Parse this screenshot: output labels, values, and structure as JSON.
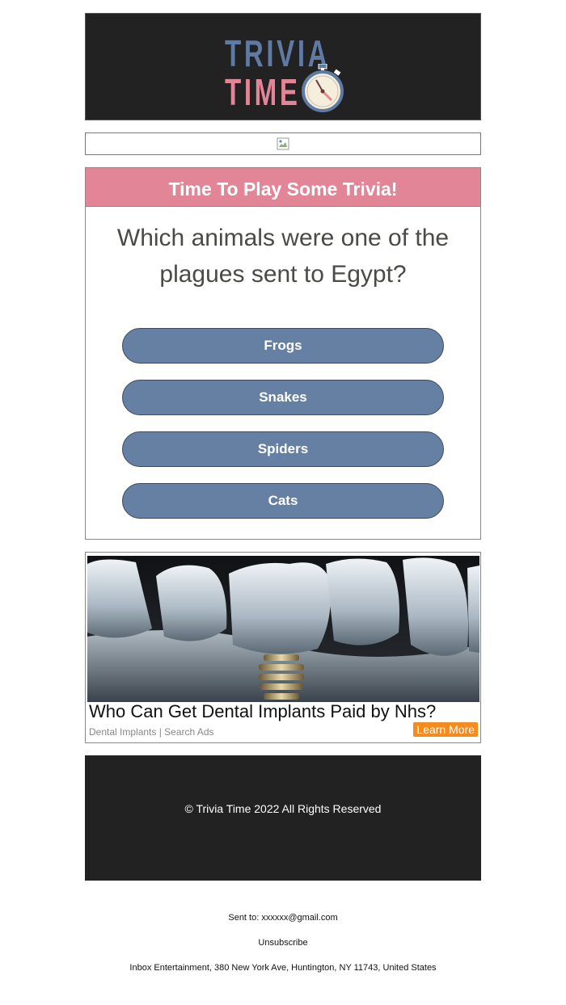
{
  "header": {
    "logo_word_1": "TRIVIA",
    "logo_word_2": "TIME",
    "logo_color_1": "#5f7aa3",
    "logo_color_2": "#e28597",
    "logo_icon": "stopwatch-icon"
  },
  "banner": {
    "icon": "broken-image-icon"
  },
  "trivia": {
    "heading": "Time To Play Some Trivia!",
    "question": "Which animals were one of the plagues sent to Egypt?",
    "answers": [
      "Frogs",
      "Snakes",
      "Spiders",
      "Cats"
    ],
    "accent_color": "#e28597",
    "button_color": "#6680a4"
  },
  "ad": {
    "title": "Who Can Get Dental Implants Paid by Nhs?",
    "source": "Dental Implants | Search Ads",
    "cta": "Learn More",
    "cta_color": "#f58b1f"
  },
  "footer": {
    "copyright": "© Trivia Time 2022 All Rights Reserved"
  },
  "meta": {
    "sent_to": "Sent to: xxxxxx@gmail.com",
    "unsubscribe": "Unsubscribe",
    "address": "Inbox Entertainment, 380 New York Ave, Huntington, NY 11743, United States"
  }
}
